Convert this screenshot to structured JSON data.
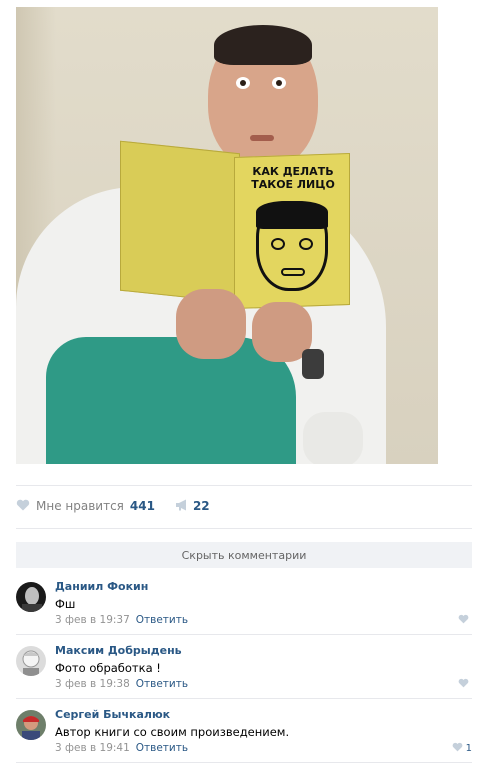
{
  "post": {
    "book_title_line1": "КАК ДЕЛАТЬ",
    "book_title_line2": "ТАКОЕ ЛИЦО",
    "likes_label": "Мне нравится",
    "likes_count": "441",
    "shares_count": "22",
    "hide_comments_label": "Скрыть комментарии"
  },
  "comments": [
    {
      "author": "Даниил Фокин",
      "text": "Фш",
      "date": "3 фев в 19:37",
      "reply": "Ответить",
      "likes": ""
    },
    {
      "author": "Максим Добрыдень",
      "text": "Фото обработка !",
      "date": "3 фев в 19:38",
      "reply": "Ответить",
      "likes": ""
    },
    {
      "author": "Сергей Бычкалюк",
      "text": "Автор книги со своим произведением.",
      "date": "3 фев в 19:41",
      "reply": "Ответить",
      "likes": "1"
    }
  ],
  "icons": {
    "like": "heart-icon",
    "share": "megaphone-icon"
  },
  "colors": {
    "link": "#2a5885",
    "muted": "#828282",
    "like_icon": "#c5d0db"
  }
}
